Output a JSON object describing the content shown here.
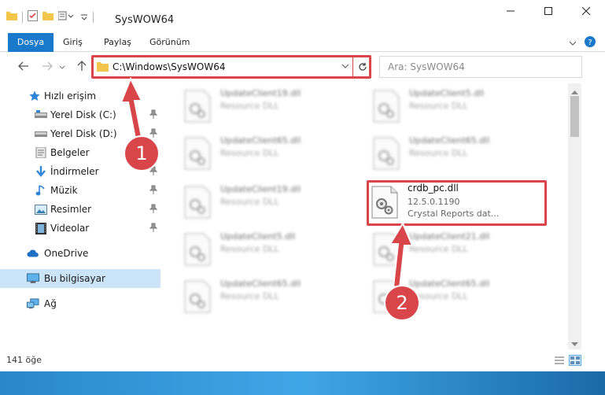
{
  "window": {
    "title": "SysWOW64",
    "controls": {
      "minimize": "minimize-icon",
      "maximize": "maximize-icon",
      "close": "close-icon"
    }
  },
  "ribbon": {
    "tabs": [
      {
        "label": "Dosya"
      },
      {
        "label": "Giriş"
      },
      {
        "label": "Paylaş"
      },
      {
        "label": "Görünüm"
      }
    ]
  },
  "navigation": {
    "address": "C:\\Windows\\SysWOW64",
    "search_placeholder": "Ara: SysWOW64"
  },
  "sidebar": {
    "items": [
      {
        "label": "Hızlı erişim",
        "icon": "star-icon"
      },
      {
        "label": "Yerel Disk (C:)",
        "icon": "drive-icon",
        "pinned": true
      },
      {
        "label": "Yerel Disk (D:)",
        "icon": "drive-icon",
        "pinned": true
      },
      {
        "label": "Belgeler",
        "icon": "documents-icon",
        "pinned": true
      },
      {
        "label": "İndirmeler",
        "icon": "download-icon",
        "pinned": true
      },
      {
        "label": "Müzik",
        "icon": "music-icon",
        "pinned": true
      },
      {
        "label": "Resimler",
        "icon": "pictures-icon",
        "pinned": true
      },
      {
        "label": "Videolar",
        "icon": "videos-icon",
        "pinned": true
      },
      {
        "label": "OneDrive",
        "icon": "cloud-icon"
      },
      {
        "label": "Bu bilgisayar",
        "icon": "computer-icon",
        "selected": true
      },
      {
        "label": "Ağ",
        "icon": "network-icon"
      }
    ]
  },
  "files": {
    "blurred": [
      {
        "name": "UpdateClient19.dll",
        "desc": "Resource DLL"
      },
      {
        "name": "UpdateClient5.dll",
        "desc": "Resource DLL"
      },
      {
        "name": "UpdateClient65.dll",
        "desc": "Resource DLL"
      },
      {
        "name": "UpdateClient65.dll",
        "desc": "Resource DLL"
      },
      {
        "name": "UpdateClient19.dll",
        "desc": "Resource DLL"
      },
      {
        "name": "UpdateClient5.dll",
        "desc": "Resource DLL"
      },
      {
        "name": "UpdateClient21.dll",
        "desc": "Resource DLL"
      },
      {
        "name": "UpdateClient65.dll",
        "desc": "Resource DLL"
      },
      {
        "name": "UpdateClient65.dll",
        "desc": "Resource DLL"
      }
    ],
    "highlighted": {
      "name": "crdb_pc.dll",
      "version": "12.5.0.1190",
      "desc": "Crystal Reports dat..."
    }
  },
  "annotations": [
    {
      "label": "1"
    },
    {
      "label": "2"
    }
  ],
  "status": {
    "count": "141 öğe"
  },
  "colors": {
    "accent": "#1979ca",
    "highlight": "#d9464a",
    "selected": "#cce4f7"
  }
}
